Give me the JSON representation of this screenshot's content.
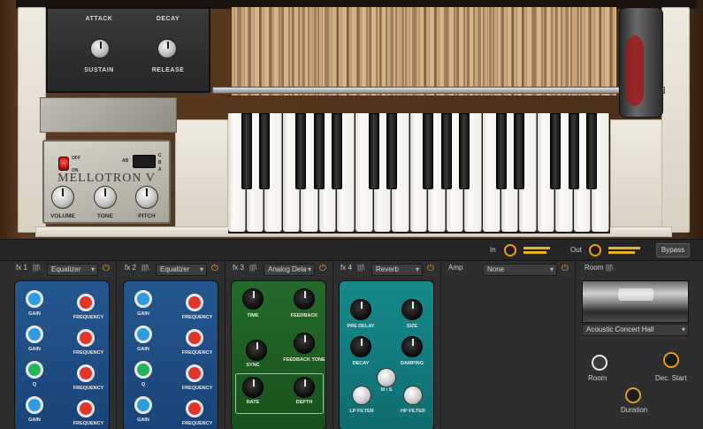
{
  "instrument": {
    "envelope": {
      "attack": "ATTACK",
      "decay": "DECAY",
      "sustain": "SUSTAIN",
      "release": "RELEASE"
    },
    "brand": "MELLOTRON V",
    "controls": {
      "volume": "VOLUME",
      "tone": "TONE",
      "pitch": "PITCH"
    },
    "power": {
      "off": "OFF",
      "on": "ON"
    },
    "selector": {
      "ab": "AB",
      "c": "C",
      "b": "B",
      "a": "A"
    }
  },
  "io": {
    "in_label": "In",
    "out_label": "Out",
    "bypass_label": "Bypass"
  },
  "fx": [
    {
      "slot": "fx 1",
      "effect": "Equalizer",
      "labels": [
        "GAIN",
        "FREQUENCY",
        "GAIN",
        "FREQUENCY",
        "Q",
        "FREQUENCY",
        "GAIN",
        "FREQUENCY"
      ]
    },
    {
      "slot": "fx 2",
      "effect": "Equalizer",
      "labels": [
        "GAIN",
        "FREQUENCY",
        "GAIN",
        "FREQUENCY",
        "Q",
        "FREQUENCY",
        "GAIN",
        "FREQUENCY"
      ]
    },
    {
      "slot": "fx 3",
      "effect": "Analog Dela",
      "labels": [
        "TIME",
        "FEEDBACK",
        "SYNC",
        "FEEDBACK TONE",
        "RATE",
        "DEPTH"
      ]
    },
    {
      "slot": "fx 4",
      "effect": "Reverb",
      "labels": [
        "PRE DELAY",
        "SIZE",
        "DECAY",
        "DAMPING",
        "M / S",
        "LP FILTER",
        "HP FILTER"
      ]
    }
  ],
  "amp": {
    "label": "Amp",
    "value": "None"
  },
  "room": {
    "label": "Room",
    "preset": "Acoustic Concert Hall",
    "knobs": [
      "Room",
      "Dec. Start",
      "Duration"
    ]
  },
  "colors": {
    "accent": "#e89a1f",
    "eq_panel": "#1f4f8c",
    "delay_panel": "#1f5a23",
    "reverb_panel": "#117a7c"
  }
}
